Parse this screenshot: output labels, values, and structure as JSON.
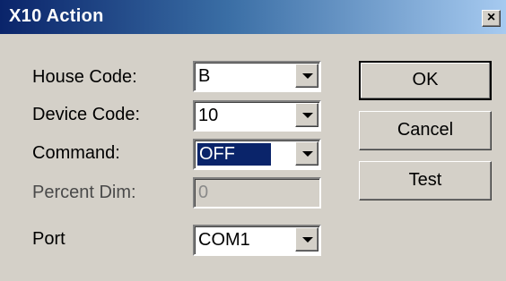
{
  "window": {
    "title": "X10 Action",
    "close_glyph": "×"
  },
  "form": {
    "house_code": {
      "label": "House Code:",
      "value": "B"
    },
    "device_code": {
      "label": "Device Code:",
      "value": "10"
    },
    "command": {
      "label": "Command:",
      "value": "OFF"
    },
    "percent_dim": {
      "label": "Percent Dim:",
      "value": "0"
    },
    "port": {
      "label": "Port",
      "value": "COM1"
    }
  },
  "buttons": {
    "ok": "OK",
    "cancel": "Cancel",
    "test": "Test"
  },
  "colors": {
    "title_start": "#0a246a",
    "title_end": "#a6caf0",
    "face": "#d4d0c8",
    "selection": "#0a246a"
  }
}
